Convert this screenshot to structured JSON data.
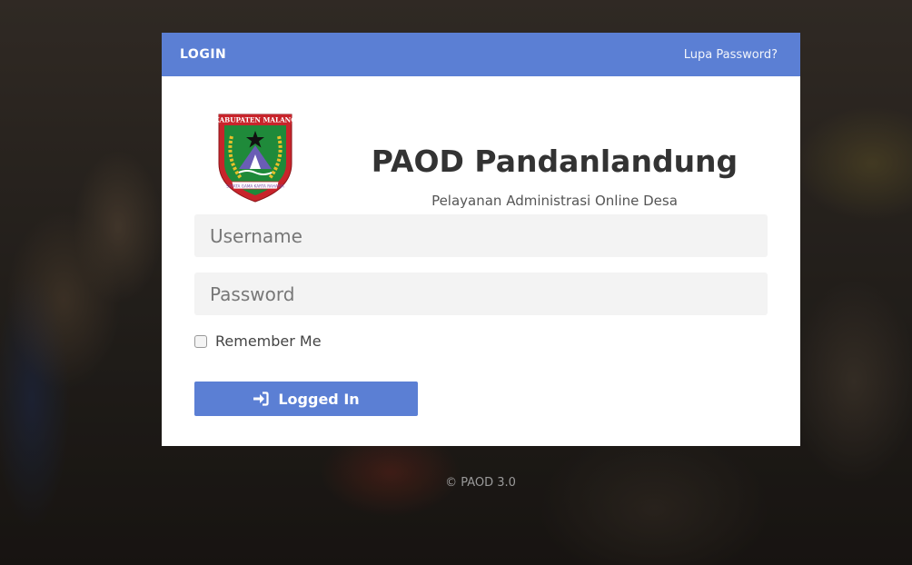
{
  "header": {
    "title": "LOGIN",
    "forgot_password": "Lupa Password?"
  },
  "brand": {
    "logo_icon": "kabupaten-malang-emblem",
    "logo_text_top": "KABUPATEN MALANG",
    "logo_text_bottom": "SATATA GAMA KARTA RAHARJA",
    "app_title": "PAOD Pandanlandung",
    "app_subtitle": "Pelayanan Administrasi Online Desa"
  },
  "form": {
    "username_placeholder": "Username",
    "username_value": "",
    "password_placeholder": "Password",
    "password_value": "",
    "remember_label": "Remember Me",
    "remember_checked": false,
    "submit_label": "Logged In",
    "submit_icon": "sign-in-icon"
  },
  "footer": {
    "copyright": "© PAOD 3.0"
  },
  "colors": {
    "accent": "#5b7fd4",
    "input_bg": "#f3f3f3"
  }
}
